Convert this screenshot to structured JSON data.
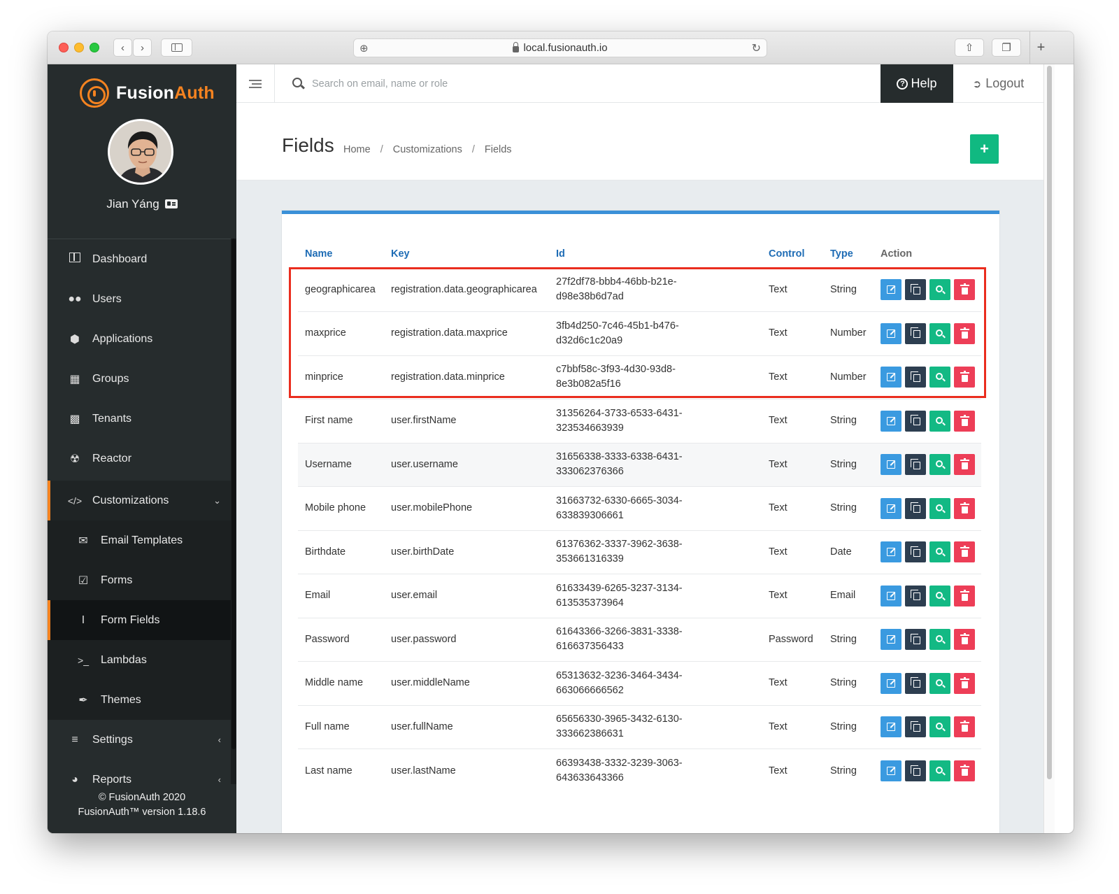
{
  "browser": {
    "url": "local.fusionauth.io"
  },
  "sidebar": {
    "brand": {
      "prefix": "Fusion",
      "suffix": "Auth"
    },
    "user_name": "Jian Yáng",
    "items": [
      {
        "label": "Dashboard",
        "icon": "dashboard-icon"
      },
      {
        "label": "Users",
        "icon": "users-icon"
      },
      {
        "label": "Applications",
        "icon": "cube-icon"
      },
      {
        "label": "Groups",
        "icon": "groups-icon"
      },
      {
        "label": "Tenants",
        "icon": "building-icon"
      },
      {
        "label": "Reactor",
        "icon": "reactor-icon"
      }
    ],
    "customizations": {
      "label": "Customizations",
      "icon": "code-icon",
      "children": [
        {
          "label": "Email Templates",
          "icon": "envelope-icon"
        },
        {
          "label": "Forms",
          "icon": "check-square-icon"
        },
        {
          "label": "Form Fields",
          "icon": "text-cursor-icon",
          "active": true
        },
        {
          "label": "Lambdas",
          "icon": "terminal-icon"
        },
        {
          "label": "Themes",
          "icon": "brush-icon"
        }
      ]
    },
    "settings": {
      "label": "Settings",
      "icon": "sliders-icon"
    },
    "reports": {
      "label": "Reports",
      "icon": "pie-chart-icon"
    },
    "footer": {
      "copyright": "© FusionAuth 2020",
      "version": "FusionAuth™ version 1.18.6"
    }
  },
  "header": {
    "search_placeholder": "Search on email, name or role",
    "help_label": "Help",
    "logout_label": "Logout"
  },
  "page": {
    "title": "Fields",
    "breadcrumb": [
      "Home",
      "Customizations",
      "Fields"
    ]
  },
  "table": {
    "headers": [
      "Name",
      "Key",
      "Id",
      "Control",
      "Type",
      "Action"
    ],
    "rows": [
      {
        "name": "geographicarea",
        "key": "registration.data.geographicarea",
        "id1": "27f2df78-bbb4-46bb-b21e-",
        "id2": "d98e38b6d7ad",
        "control": "Text",
        "type": "String"
      },
      {
        "name": "maxprice",
        "key": "registration.data.maxprice",
        "id1": "3fb4d250-7c46-45b1-b476-",
        "id2": "d32d6c1c20a9",
        "control": "Text",
        "type": "Number"
      },
      {
        "name": "minprice",
        "key": "registration.data.minprice",
        "id1": "c7bbf58c-3f93-4d30-93d8-",
        "id2": "8e3b082a5f16",
        "control": "Text",
        "type": "Number"
      },
      {
        "name": "First name",
        "key": "user.firstName",
        "id1": "31356264-3733-6533-6431-",
        "id2": "323534663939",
        "control": "Text",
        "type": "String"
      },
      {
        "name": "Username",
        "key": "user.username",
        "id1": "31656338-3333-6338-6431-",
        "id2": "333062376366",
        "control": "Text",
        "type": "String"
      },
      {
        "name": "Mobile phone",
        "key": "user.mobilePhone",
        "id1": "31663732-6330-6665-3034-",
        "id2": "633839306661",
        "control": "Text",
        "type": "String"
      },
      {
        "name": "Birthdate",
        "key": "user.birthDate",
        "id1": "61376362-3337-3962-3638-",
        "id2": "353661316339",
        "control": "Text",
        "type": "Date"
      },
      {
        "name": "Email",
        "key": "user.email",
        "id1": "61633439-6265-3237-3134-",
        "id2": "613535373964",
        "control": "Text",
        "type": "Email"
      },
      {
        "name": "Password",
        "key": "user.password",
        "id1": "61643366-3266-3831-3338-",
        "id2": "616637356433",
        "control": "Password",
        "type": "String"
      },
      {
        "name": "Middle name",
        "key": "user.middleName",
        "id1": "65313632-3236-3464-3434-",
        "id2": "663066666562",
        "control": "Text",
        "type": "String"
      },
      {
        "name": "Full name",
        "key": "user.fullName",
        "id1": "65656330-3965-3432-6130-",
        "id2": "333662386631",
        "control": "Text",
        "type": "String"
      },
      {
        "name": "Last name",
        "key": "user.lastName",
        "id1": "66393438-3332-3239-3063-",
        "id2": "643633643366",
        "control": "Text",
        "type": "String"
      }
    ]
  },
  "colors": {
    "sidebar_bg": "#262c2d",
    "brand_accent": "#f58320",
    "panel_top_border": "#3b90d8",
    "add_button": "#10b981",
    "edit": "#3a9ae0",
    "duplicate": "#2d3e50",
    "view": "#13b984",
    "delete": "#ed3e57",
    "highlight": "#ea2d1e"
  }
}
